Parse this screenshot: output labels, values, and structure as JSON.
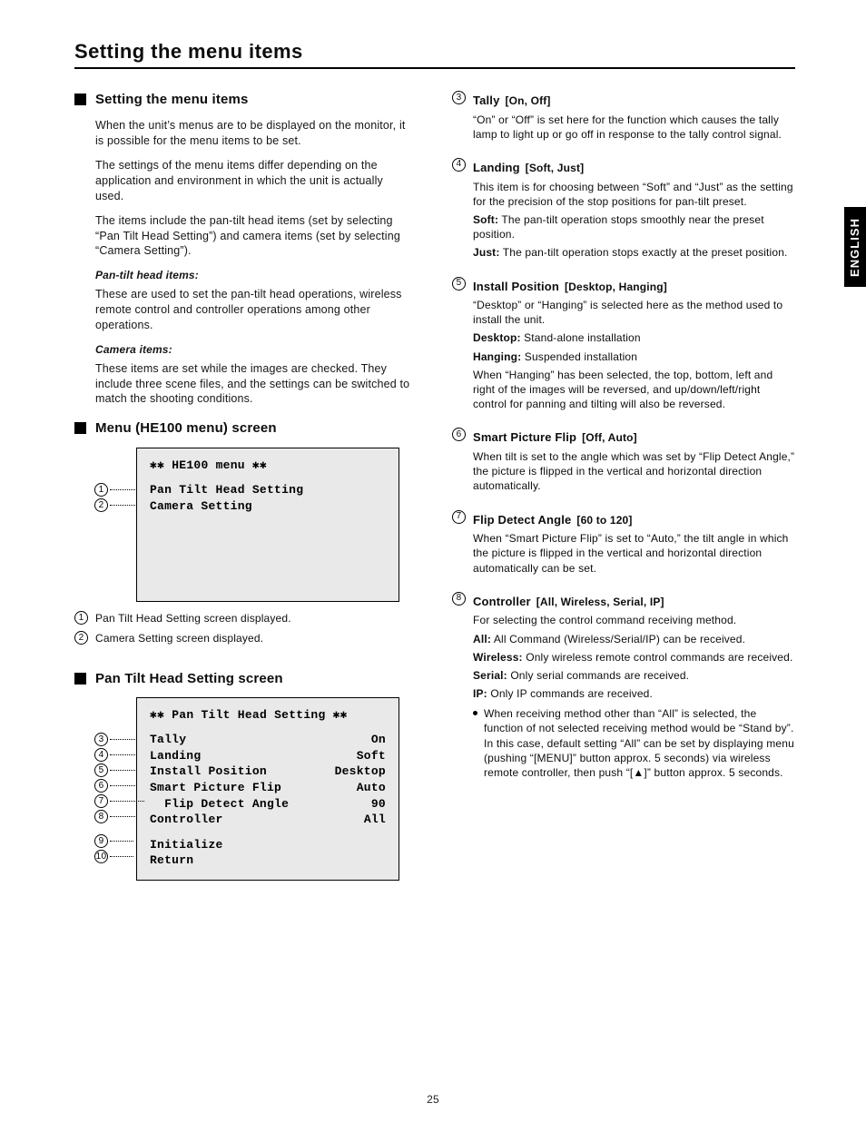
{
  "page_title": "Setting the menu items",
  "page_number": "25",
  "english_tab": "ENGLISH",
  "sections": {
    "setting_items": {
      "title": "Setting the menu items",
      "p1": "When the unit’s menus are to be displayed on the monitor, it is possible for the menu items to be set.",
      "p2": "The settings of the menu items differ depending on the application and environment in which the unit is actually used.",
      "p3": "The items include the pan-tilt head items (set by selecting “Pan Tilt Head Setting”) and camera items (set by selecting “Camera Setting”).",
      "p4_label": "Pan-tilt head items:",
      "p4_text": "These are used to set the pan-tilt head operations, wireless remote control and controller operations among other operations.",
      "p5_label": "Camera items:",
      "p5_text": "These items are set while the images are checked. They include three scene files, and the settings can be switched to match the shooting conditions."
    },
    "menu_screen": {
      "title": "Menu (HE100 menu) screen"
    },
    "pth_screen": {
      "title": "Pan Tilt Head Setting screen"
    }
  },
  "menu_panel_1": {
    "title": "✱✱ HE100 menu ✱✱",
    "rows": [
      {
        "n": "1",
        "label": "Pan Tilt Head Setting",
        "value": ""
      },
      {
        "n": "2",
        "label": "Camera Setting",
        "value": ""
      }
    ],
    "below": [
      {
        "n": "1",
        "text": "Pan Tilt Head Setting screen displayed."
      },
      {
        "n": "2",
        "text": "Camera Setting screen displayed."
      }
    ]
  },
  "menu_panel_2": {
    "title": "✱✱ Pan Tilt Head Setting ✱✱",
    "rows": [
      {
        "n": "3",
        "label": "Tally",
        "value": "On"
      },
      {
        "n": "4",
        "label": "Landing",
        "value": "Soft"
      },
      {
        "n": "5",
        "label": "Install Position",
        "value": "Desktop"
      },
      {
        "n": "6",
        "label": "Smart Picture Flip",
        "value": "Auto"
      },
      {
        "n": "7",
        "label": "Flip Detect Angle",
        "value": "90"
      },
      {
        "n": "8",
        "label": "Controller",
        "value": "All"
      },
      {
        "n": "9",
        "label": "Initialize",
        "value": ""
      },
      {
        "n": "10",
        "label": "Return",
        "value": ""
      }
    ]
  },
  "right_items": [
    {
      "n": "3",
      "title": "Tally",
      "opts": "[On, Off]",
      "desc": "“On” or “Off” is set here for the function which causes the tally lamp to light up or go off in response to the tally control signal.",
      "subs": []
    },
    {
      "n": "4",
      "title": "Landing",
      "opts": "[Soft, Just]",
      "desc": "This item is for choosing between “Soft” and “Just” as the setting for the precision of the stop positions for pan-tilt preset.",
      "subs": [
        {
          "label": "Soft:",
          "text": "The pan-tilt operation stops smoothly near the preset position."
        },
        {
          "label": "Just:",
          "text": "The pan-tilt operation stops exactly at the preset position."
        }
      ]
    },
    {
      "n": "5",
      "title": "Install Position",
      "opts": "[Desktop, Hanging]",
      "desc": "“Desktop” or “Hanging” is selected here as the method used to install the unit.",
      "subs": [
        {
          "label": "Desktop:",
          "text": "Stand-alone installation"
        },
        {
          "label": "Hanging:",
          "text": "Suspended installation"
        },
        {
          "label": "",
          "text": "When “Hanging” has been selected, the top, bottom, left and right of the images will be reversed, and up/down/left/right control for panning and tilting will also be reversed."
        }
      ]
    },
    {
      "n": "6",
      "title": "Smart Picture Flip",
      "opts": "[Off, Auto]",
      "desc": "When tilt is set to the angle which was set by “Flip Detect Angle,” the picture is flipped in the vertical and horizontal direction automatically.",
      "subs": []
    },
    {
      "n": "7",
      "title": "Flip Detect Angle",
      "opts": "[60 to 120]",
      "desc": "When “Smart Picture Flip” is set to “Auto,” the tilt angle in which the picture is flipped in the vertical and horizontal direction automatically can be set.",
      "subs": []
    },
    {
      "n": "8",
      "title": "Controller",
      "opts": "[All, Wireless, Serial, IP]",
      "desc": "For selecting the control command receiving method.",
      "subs": [
        {
          "label": "All:",
          "text": "All Command (Wireless/Serial/IP) can be received."
        },
        {
          "label": "Wireless:",
          "text": "Only wireless remote control commands are received."
        },
        {
          "label": "Serial:",
          "text": "Only serial commands are received."
        },
        {
          "label": "IP:",
          "text": "Only IP commands are received."
        }
      ],
      "bullet": "When receiving method other than “All” is selected, the function of not selected receiving method would be “Stand by”. In this case, default setting “All” can be set by displaying menu (pushing “[MENU]” button approx. 5 seconds) via wireless remote controller, then push “[▲]” button approx. 5 seconds."
    }
  ]
}
